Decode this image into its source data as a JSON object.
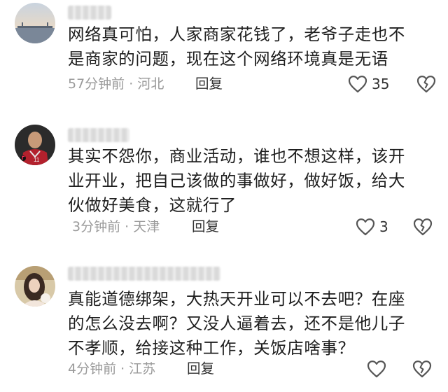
{
  "comments": [
    {
      "text": "网络真可怕，人家商家花钱了，老爷子走也不\n是商家的问题，现在这个网络环境真是无语",
      "time": "57分钟前",
      "location": "河北",
      "reply_label": "回复",
      "likes": "35",
      "avatar_icon": "landscape-avatar-icon"
    },
    {
      "text": "其实不怨你，商业活动，谁也不想这样，该开\n业开业，把自己该做的事做好，做好饭，给大\n伙做好美食，这就行了",
      "time": "3分钟前",
      "location": "天津",
      "reply_label": "回复",
      "likes": "3",
      "avatar_icon": "basketball-player-avatar-icon"
    },
    {
      "text": "真能道德绑架，大热天开业可以不去吧？在座\n的怎么没去啊？又没人逼着去，还不是他儿子\n不孝顺，给接这种工作，关饭店啥事？",
      "time": "4分钟前",
      "location": "江苏",
      "reply_label": "回复",
      "likes": "",
      "avatar_icon": "girl-portrait-avatar-icon"
    }
  ],
  "meta_separator": " · ",
  "colors": {
    "text": "#1e1e1e",
    "meta": "#9a9a9a",
    "icon": "#555555"
  }
}
